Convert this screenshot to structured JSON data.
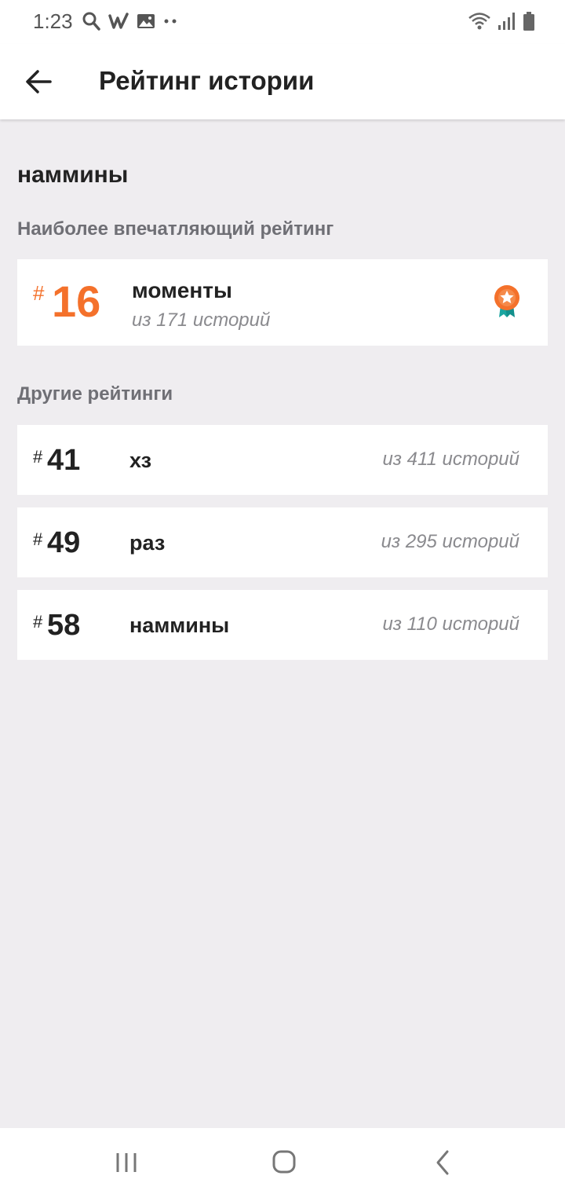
{
  "status_bar": {
    "time": "1:23",
    "icons": [
      "search-icon",
      "w-app-icon",
      "image-icon",
      "more-dots-icon",
      "wifi-icon",
      "signal-icon",
      "battery-icon"
    ]
  },
  "app_bar": {
    "title": "Рейтинг истории",
    "back_icon": "arrow-left-icon"
  },
  "story": {
    "name": "наммины"
  },
  "featured": {
    "section_label": "Наиболее впечатляющий рейтинг",
    "hash": "#",
    "rank": "16",
    "tag": "моменты",
    "count": "из 171 историй",
    "icon": "award-badge-icon",
    "accent_color": "#f4712b"
  },
  "others": {
    "section_label": "Другие рейтинги",
    "items": [
      {
        "hash": "#",
        "rank": "41",
        "tag": "хз",
        "count": "из 411 историй"
      },
      {
        "hash": "#",
        "rank": "49",
        "tag": "раз",
        "count": "из 295 историй"
      },
      {
        "hash": "#",
        "rank": "58",
        "tag": "наммины",
        "count": "из 110 историй"
      }
    ]
  },
  "nav_bar": {
    "icons": [
      "recent-apps-icon",
      "home-icon",
      "back-icon"
    ]
  }
}
